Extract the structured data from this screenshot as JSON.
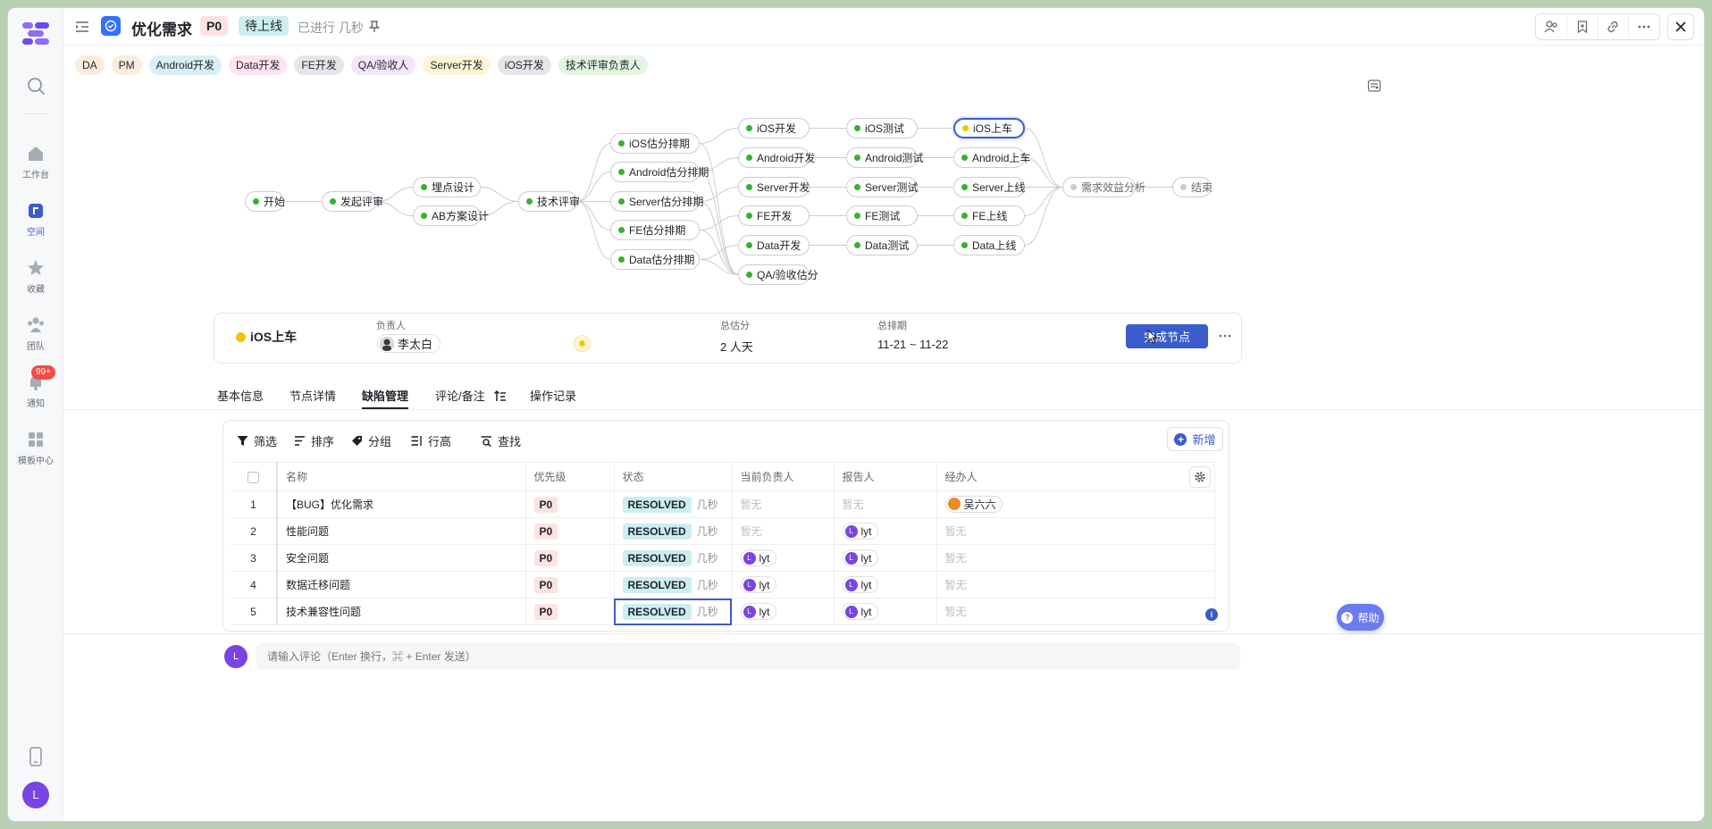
{
  "colors": {
    "accent": "#3a5ccc",
    "done": "#34b233",
    "current": "#f5c400",
    "pending": "#c9cdd4"
  },
  "nav": {
    "items": [
      {
        "label": "工作台",
        "icon": "home-icon"
      },
      {
        "label": "空间",
        "icon": "space-icon"
      },
      {
        "label": "收藏",
        "icon": "star-icon"
      },
      {
        "label": "团队",
        "icon": "team-icon"
      },
      {
        "label": "通知",
        "icon": "bell-icon",
        "badge": "99+"
      },
      {
        "label": "模板中心",
        "icon": "template-icon"
      }
    ],
    "avatar": "L"
  },
  "header": {
    "title": "优化需求",
    "priority": "P0",
    "status": "待上线",
    "time": "已进行 几秒"
  },
  "roles": [
    {
      "label": "DA",
      "color": "#fdebdc"
    },
    {
      "label": "PM",
      "color": "#fdebdc"
    },
    {
      "label": "Android开发",
      "color": "#d8f0f7"
    },
    {
      "label": "Data开发",
      "color": "#fde4f0"
    },
    {
      "label": "FE开发",
      "color": "#e4e6ea"
    },
    {
      "label": "QA/验收人",
      "color": "#f3e5fb"
    },
    {
      "label": "Server开发",
      "color": "#fdf5d6"
    },
    {
      "label": "iOS开发",
      "color": "#e4e6ea"
    },
    {
      "label": "技术评审负责人",
      "color": "#e3f5e1"
    }
  ],
  "flow": {
    "start": "开始",
    "review": "发起评审",
    "tracking": "埋点设计",
    "ab": "AB方案设计",
    "tech_review": "技术评审",
    "est_ios": "iOS估分排期",
    "est_android": "Android估分排期",
    "est_server": "Server估分排期",
    "est_fe": "FE估分排期",
    "est_data": "Data估分排期",
    "dev_ios": "iOS开发",
    "dev_android": "Android开发",
    "dev_server": "Server开发",
    "dev_fe": "FE开发",
    "dev_data": "Data开发",
    "qa_est": "QA/验收估分",
    "test_ios": "iOS测试",
    "test_android": "Android测试",
    "test_server": "Server测试",
    "test_fe": "FE测试",
    "test_data": "Data测试",
    "rel_ios": "iOS上车",
    "rel_android": "Android上车",
    "rel_server": "Server上线",
    "rel_fe": "FE上线",
    "rel_data": "Data上线",
    "benefit": "需求效益分析",
    "end": "结束"
  },
  "card": {
    "title": "iOS上车",
    "owner_label": "负责人",
    "owner": "李太白",
    "estimate_label": "总估分",
    "estimate": "2 人天",
    "schedule_label": "总排期",
    "schedule": "11-21 ~ 11-22",
    "done_button": "完成节点"
  },
  "tabs": [
    "基本信息",
    "节点详情",
    "缺陷管理",
    "评论/备注",
    "操作记录"
  ],
  "toolbar": {
    "filter": "筛选",
    "sort": "排序",
    "group": "分组",
    "row_height": "行高",
    "search": "查找",
    "add": "新增"
  },
  "table": {
    "columns": [
      "名称",
      "优先级",
      "状态",
      "当前负责人",
      "报告人",
      "经办人"
    ],
    "none": "暂无",
    "rows": [
      {
        "idx": "1",
        "name": "【BUG】优化需求",
        "priority": "P0",
        "status": "RESOLVED",
        "time": "几秒",
        "assignee": "",
        "reporter": "",
        "handler": "吴六六"
      },
      {
        "idx": "2",
        "name": "性能问题",
        "priority": "P0",
        "status": "RESOLVED",
        "time": "几秒",
        "assignee": "",
        "reporter": "lyt",
        "handler": ""
      },
      {
        "idx": "3",
        "name": "安全问题",
        "priority": "P0",
        "status": "RESOLVED",
        "time": "几秒",
        "assignee": "lyt",
        "reporter": "lyt",
        "handler": ""
      },
      {
        "idx": "4",
        "name": "数据迁移问题",
        "priority": "P0",
        "status": "RESOLVED",
        "time": "几秒",
        "assignee": "lyt",
        "reporter": "lyt",
        "handler": ""
      },
      {
        "idx": "5",
        "name": "技术兼容性问题",
        "priority": "P0",
        "status": "RESOLVED",
        "time": "几秒",
        "assignee": "lyt",
        "reporter": "lyt",
        "handler": ""
      }
    ]
  },
  "comment": {
    "avatar": "L",
    "placeholder": "请输入评论（Enter 换行，⌘ + Enter 发送）"
  },
  "help": "帮助"
}
